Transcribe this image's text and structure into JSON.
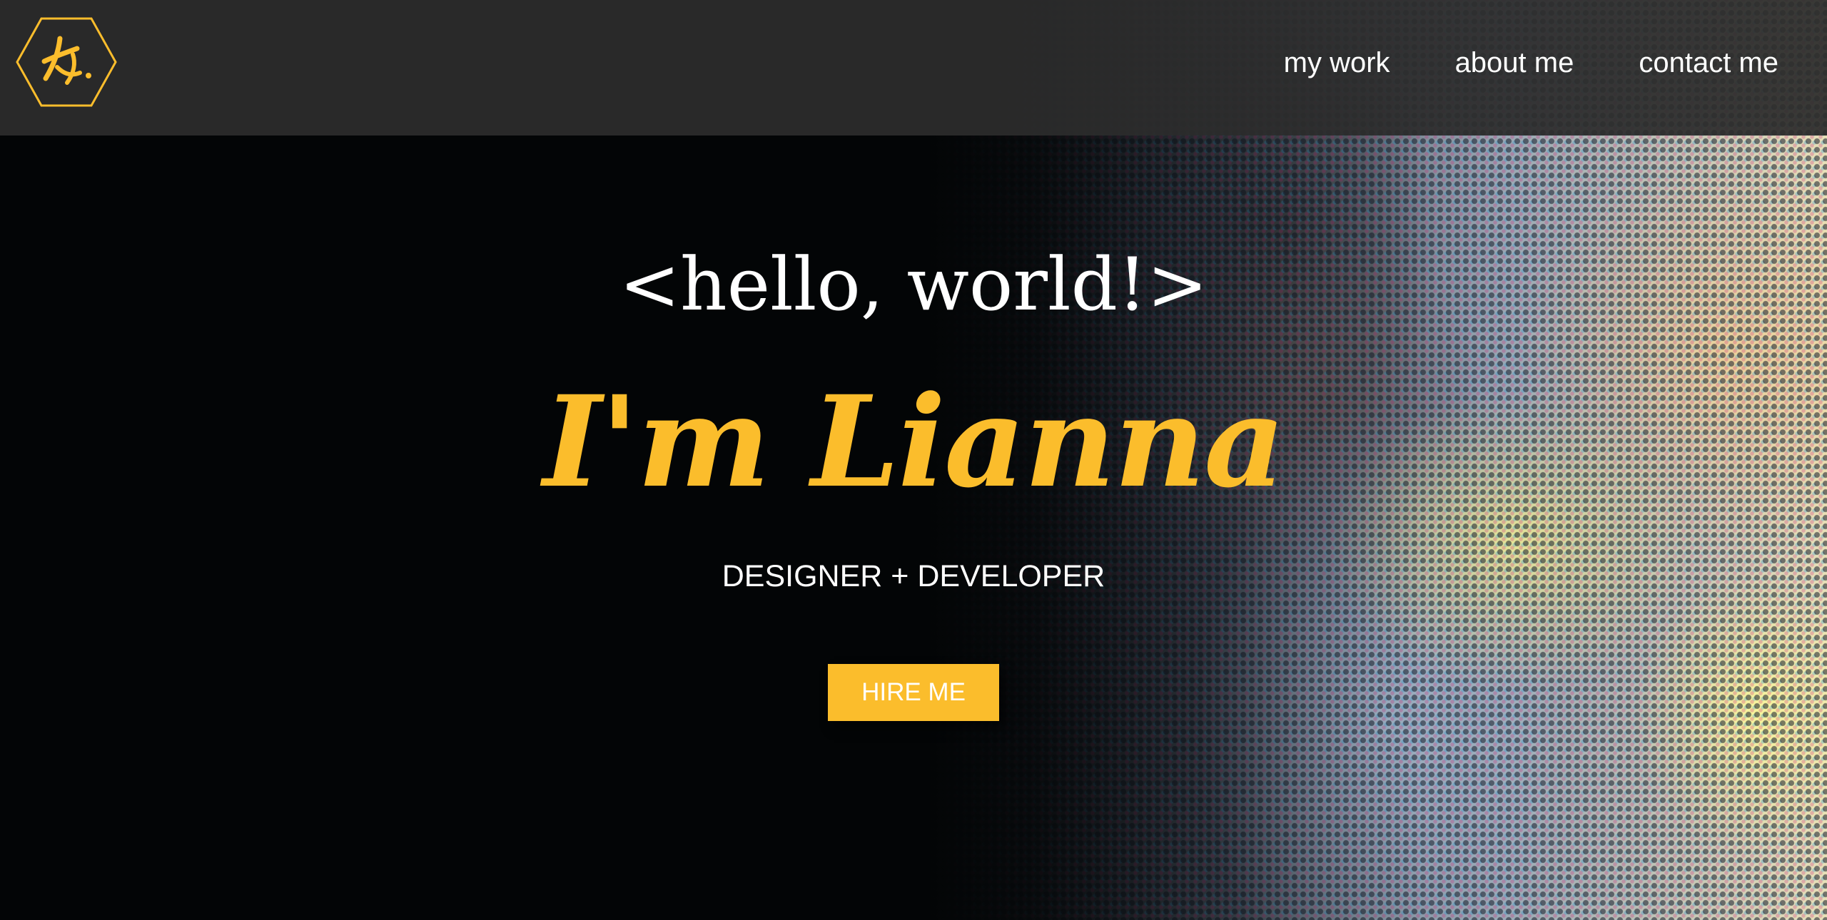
{
  "header": {
    "logo_icon": "hexagon-signature-logo-icon",
    "nav": [
      {
        "label": "my work"
      },
      {
        "label": "about me"
      },
      {
        "label": "contact me"
      }
    ]
  },
  "hero": {
    "greeting": "<hello, world!>",
    "name": "I'm Lianna",
    "tagline": "DESIGNER + DEVELOPER",
    "cta_label": "HIRE ME"
  },
  "colors": {
    "accent": "#fbbd2c",
    "header_bg": "#2c2c2c",
    "page_bg": "#030506",
    "text": "#ffffff"
  }
}
